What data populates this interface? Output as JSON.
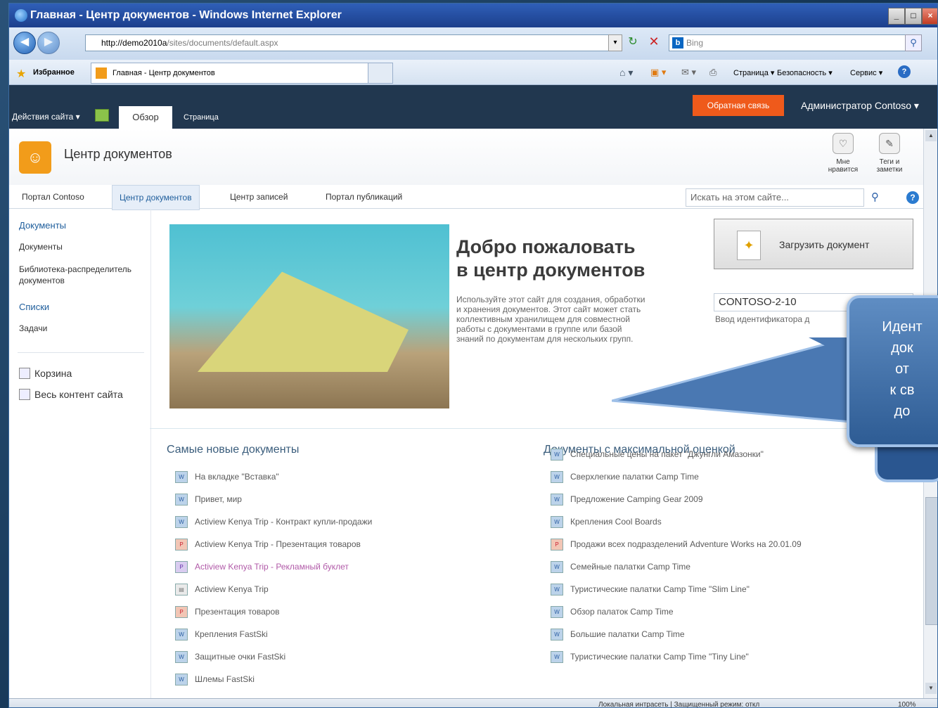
{
  "window": {
    "title": "Главная - Центр документов - Windows Internet Explorer",
    "controls": [
      "_",
      "□",
      "×"
    ]
  },
  "browser": {
    "url_host": "http://demo2010a",
    "url_path": "/sites/documents/default.aspx",
    "search_engine": "Bing",
    "favorites_label": "Избранное",
    "tab_title": "Главная - Центр документов",
    "toolbar_items": [
      "Страница ▾",
      "Безопасность ▾",
      "Сервис ▾"
    ]
  },
  "ribbon": {
    "site_actions": "Действия сайта ▾",
    "tab_overview": "Обзор",
    "tab_page": "Страница",
    "feedback": "Обратная связь",
    "user": "Администратор Contoso ▾"
  },
  "site": {
    "title": "Центр документов",
    "like_label_1": "Мне",
    "like_label_2": "нравится",
    "tags_label_1": "Теги и",
    "tags_label_2": "заметки"
  },
  "topnav": {
    "items": [
      "Портал Contoso",
      "Центр документов",
      "Центр записей",
      "Портал публикаций"
    ],
    "search_placeholder": "Искать на этом сайте..."
  },
  "quicklaunch": {
    "documents_header": "Документы",
    "documents_item": "Документы",
    "library_line1": "Библиотека-распределитель",
    "library_line2": "документов",
    "lists_header": "Списки",
    "tasks": "Задачи",
    "recycle": "Корзина",
    "all_content": "Весь контент сайта"
  },
  "welcome": {
    "title_line1": "Добро пожаловать",
    "title_line2": "в центр документов",
    "desc_lines": [
      "Используйте этот сайт для создания, обработки",
      "и хранения документов. Этот сайт может стать",
      "коллективным хранилищем для совместной",
      "работы с документами в группе или базой",
      "знаний по документам для нескольких групп."
    ],
    "upload_button": "Загрузить документ",
    "doc_id_value": "CONTOSO-2-10",
    "doc_id_hint": "Ввод идентификатора д"
  },
  "newest_docs": {
    "header": "Самые новые документы",
    "items": [
      "На вкладке \"Вставка\"",
      "Привет, мир",
      "Actiview Kenya Trip - Контракт купли-продажи",
      "Actiview Kenya Trip - Презентация товаров",
      "Actiview Kenya Trip - Рекламный буклет",
      "Actiview Kenya Trip",
      "Презентация товаров",
      "Крепления FastSki",
      "Защитные очки FastSki",
      "Шлемы FastSki"
    ]
  },
  "top_rated_docs": {
    "header": "Документы с максимальной оценкой",
    "items": [
      "Специальные цены на пакет \"Джунгли Амазонки\"",
      "Сверхлегкие палатки Camp Time",
      "Предложение Camping Gear 2009",
      "Крепления Cool Boards",
      "Продажи всех подразделений Adventure Works на 20.01.09",
      "Семейные палатки Camp Time",
      "Туристические палатки Camp Time \"Slim Line\"",
      "Обзор палаток Camp Time",
      "Большие палатки Camp Time",
      "Туристические палатки Camp Time \"Tiny Line\""
    ]
  },
  "statusbar": {
    "zone": "Локальная интрасеть | Защищенный режим: откл",
    "zoom": "100%"
  },
  "callout": {
    "lines": [
      "Идент",
      "док",
      "от",
      "к св",
      "до"
    ]
  }
}
